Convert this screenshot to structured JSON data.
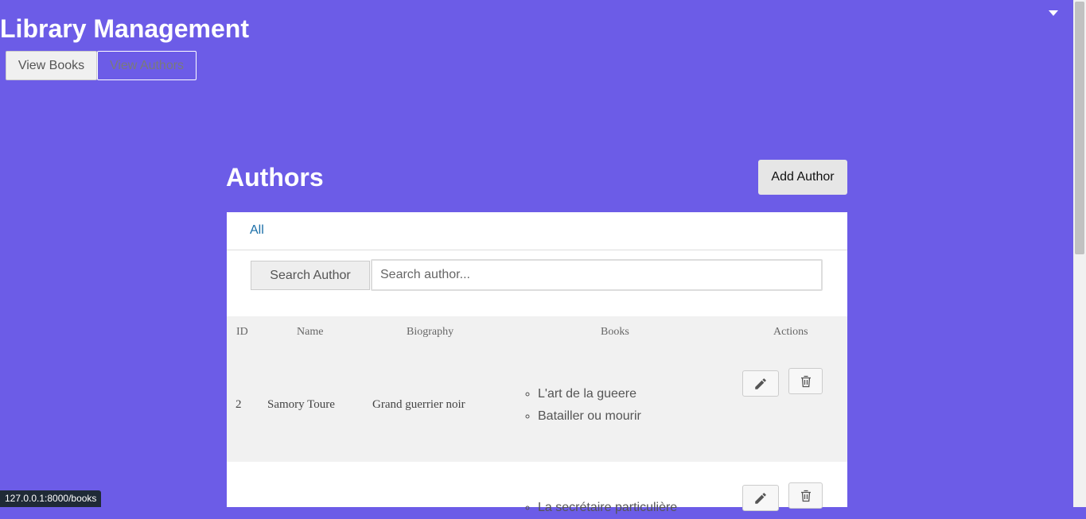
{
  "header": {
    "title": "Library Management",
    "nav": [
      {
        "label": "View Books"
      },
      {
        "label": "View Authors"
      }
    ]
  },
  "main": {
    "heading": "Authors",
    "add_button": "Add Author",
    "filter": "All",
    "search": {
      "label": "Search Author",
      "placeholder": "Search author..."
    },
    "table": {
      "columns": [
        "ID",
        "Name",
        "Biography",
        "Books",
        "Actions"
      ],
      "rows": [
        {
          "id": "2",
          "name": "Samory Toure",
          "biography": "Grand guerrier noir",
          "books": [
            "L'art de la gueere",
            "Batailler ou mourir"
          ]
        },
        {
          "id": "",
          "name": "",
          "biography": "",
          "books": [
            "La secrétaire particulière"
          ]
        }
      ]
    }
  },
  "status_bar": "127.0.0.1:8000/books",
  "icons": [
    "pencil-icon",
    "trash-icon",
    "chevron-down-icon"
  ],
  "colors": {
    "background": "#6c5ce7",
    "link": "#1a6ea8"
  }
}
